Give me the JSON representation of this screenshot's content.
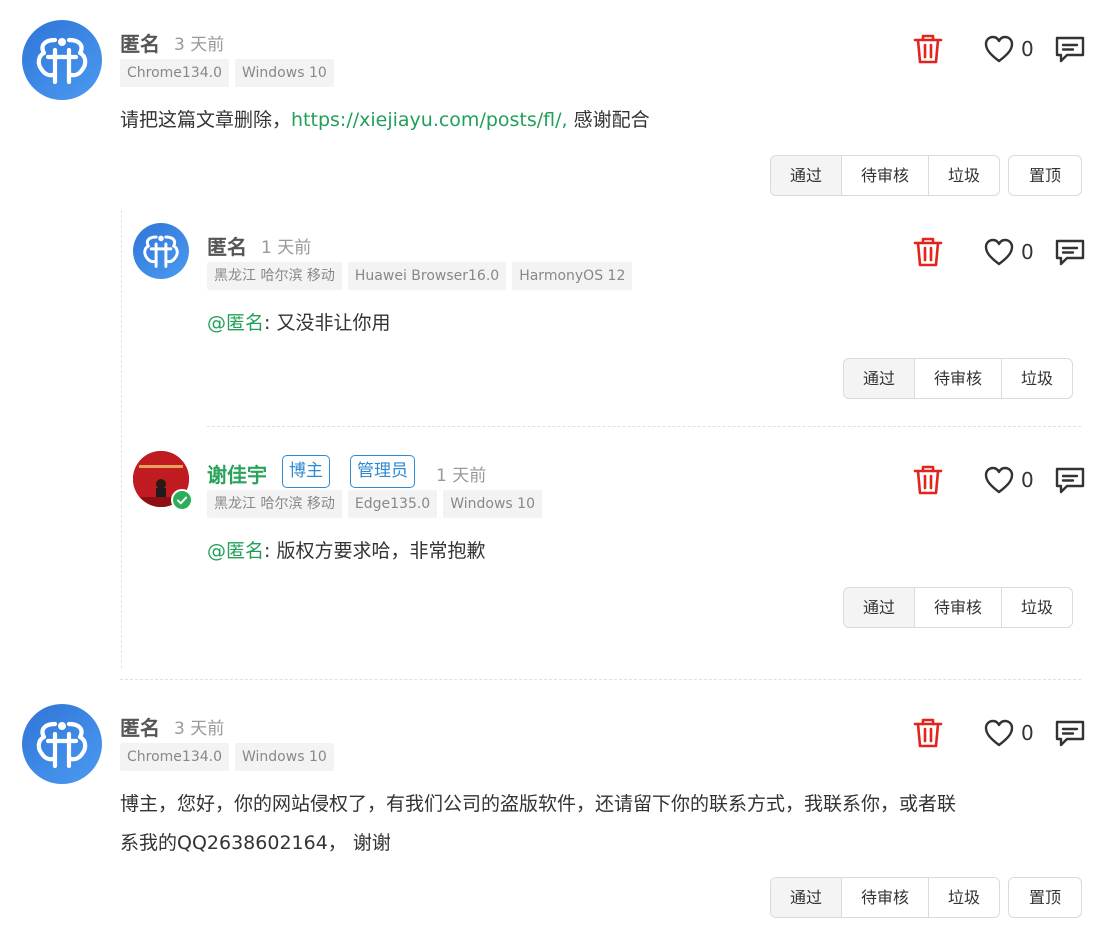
{
  "comments": [
    {
      "author": "匿名",
      "time": "3 天前",
      "tags": [
        "Chrome134.0",
        "Windows 10"
      ],
      "content_before": "请把这篇文章删除，",
      "link": "https://xiejiayu.com/posts/fl/,",
      "content_after": " 感谢配合",
      "likes": "0",
      "moderation": [
        "通过",
        "待审核",
        "垃圾"
      ],
      "pin_label": "置顶",
      "replies": [
        {
          "author": "匿名",
          "time": "1 天前",
          "tags": [
            "黑龙江 哈尔滨 移动",
            "Huawei Browser16.0",
            "HarmonyOS 12"
          ],
          "mention": "@匿名",
          "content": ": 又没非让你用",
          "likes": "0",
          "moderation": [
            "通过",
            "待审核",
            "垃圾"
          ]
        },
        {
          "author": "谢佳宇",
          "badges": [
            "博主",
            "管理员"
          ],
          "time": "1 天前",
          "tags": [
            "黑龙江 哈尔滨 移动",
            "Edge135.0",
            "Windows 10"
          ],
          "mention": "@匿名",
          "content": ": 版权方要求哈，非常抱歉",
          "likes": "0",
          "moderation": [
            "通过",
            "待审核",
            "垃圾"
          ]
        }
      ]
    },
    {
      "author": "匿名",
      "time": "3 天前",
      "tags": [
        "Chrome134.0",
        "Windows 10"
      ],
      "content_line1": "博主，您好，你的网站侵权了，有我们公司的盗版软件，还请留下你的联系方式，我联系你，或者联",
      "content_line2": "系我的QQ2638602164， 谢谢",
      "likes": "0",
      "moderation": [
        "通过",
        "待审核",
        "垃圾"
      ],
      "pin_label": "置顶"
    }
  ],
  "colors": {
    "accent_green": "#22a05a",
    "badge_blue": "#2d8ad3",
    "delete_red": "#e3231c"
  },
  "icons": {
    "delete": "trash-icon",
    "like": "heart-icon",
    "reply": "comment-icon",
    "verified": "check-badge-icon"
  }
}
